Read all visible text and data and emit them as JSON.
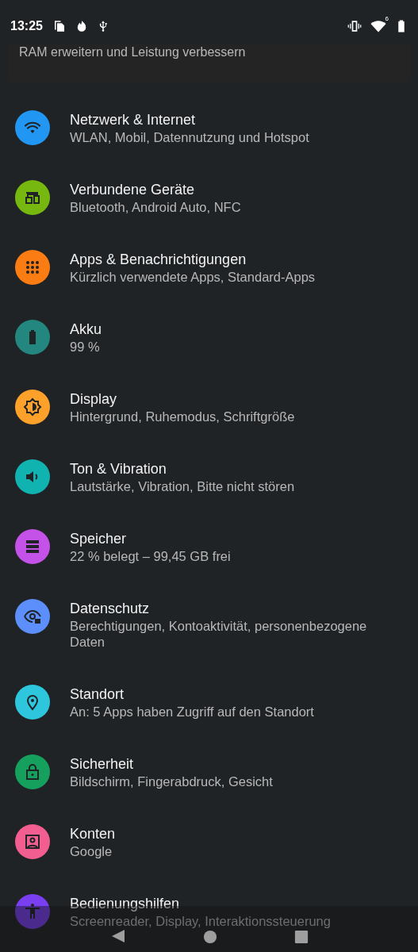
{
  "status_bar": {
    "time": "13:25",
    "wifi_badge": "6"
  },
  "banner": {
    "text": "RAM erweitern und Leistung verbessern"
  },
  "settings": [
    {
      "title": "Netzwerk & Internet",
      "subtitle": "WLAN, Mobil, Datennutzung und Hotspot",
      "color": "#2196f3"
    },
    {
      "title": "Verbundene Geräte",
      "subtitle": "Bluetooth, Android Auto, NFC",
      "color": "#76b80f"
    },
    {
      "title": "Apps & Benachrichtigungen",
      "subtitle": "Kürzlich verwendete Apps, Standard-Apps",
      "color": "#fb7c12"
    },
    {
      "title": "Akku",
      "subtitle": "99 %",
      "color": "#23867f"
    },
    {
      "title": "Display",
      "subtitle": "Hintergrund, Ruhemodus, Schriftgröße",
      "color": "#fea12b"
    },
    {
      "title": "Ton & Vibration",
      "subtitle": "Lautstärke, Vibration, Bitte nicht stören",
      "color": "#10b3b0"
    },
    {
      "title": "Speicher",
      "subtitle": "22 % belegt – 99,45 GB frei",
      "color": "#c451e8"
    },
    {
      "title": "Datenschutz",
      "subtitle": "Berechtigungen, Kontoaktivität, personenbezogene Daten",
      "color": "#5c8ffb"
    },
    {
      "title": "Standort",
      "subtitle": "An: 5 Apps haben Zugriff auf den Standort",
      "color": "#2ec6dd"
    },
    {
      "title": "Sicherheit",
      "subtitle": "Bildschirm, Fingerabdruck, Gesicht",
      "color": "#16a05e"
    },
    {
      "title": "Konten",
      "subtitle": "Google",
      "color": "#f25e90"
    },
    {
      "title": "Bedienungshilfen",
      "subtitle": "Screenreader, Display, Interaktionssteuerung",
      "color": "#7b3ff2"
    }
  ]
}
